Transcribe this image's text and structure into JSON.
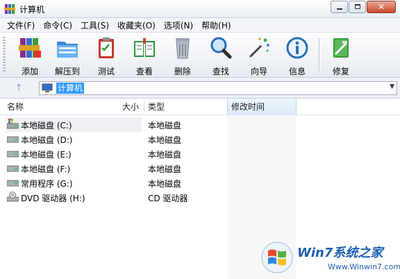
{
  "window": {
    "title": "计算机"
  },
  "menu": [
    "文件(F)",
    "命令(C)",
    "工具(S)",
    "收藏夹(O)",
    "选项(N)",
    "帮助(H)"
  ],
  "toolbar": [
    {
      "label": "添加",
      "icon": "add-archive-icon"
    },
    {
      "label": "解压到",
      "icon": "extract-folder-icon"
    },
    {
      "label": "测试",
      "icon": "test-clipboard-icon"
    },
    {
      "label": "查看",
      "icon": "view-book-icon"
    },
    {
      "label": "删除",
      "icon": "trash-icon"
    },
    {
      "label": "查找",
      "icon": "magnifier-icon"
    },
    {
      "label": "向导",
      "icon": "wizard-wand-icon"
    },
    {
      "label": "信息",
      "icon": "info-icon"
    },
    {
      "label": "修复",
      "icon": "repair-icon"
    }
  ],
  "address": {
    "value": "计算机"
  },
  "columns": {
    "name": "名称",
    "size": "大小",
    "type": "类型",
    "modified": "修改时间"
  },
  "rows": [
    {
      "name": "本地磁盘 (C:)",
      "type": "本地磁盘",
      "icon": "system-drive-icon"
    },
    {
      "name": "本地磁盘 (D:)",
      "type": "本地磁盘",
      "icon": "hard-drive-icon"
    },
    {
      "name": "本地磁盘 (E:)",
      "type": "本地磁盘",
      "icon": "hard-drive-icon"
    },
    {
      "name": "本地磁盘 (F:)",
      "type": "本地磁盘",
      "icon": "hard-drive-icon"
    },
    {
      "name": "常用程序 (G:)",
      "type": "本地磁盘",
      "icon": "hard-drive-icon"
    },
    {
      "name": "DVD 驱动器 (H:)",
      "type": "CD 驱动器",
      "icon": "dvd-drive-icon"
    }
  ],
  "watermark": {
    "brand": "Win7系统之家",
    "url": "Www.Winwin7.com"
  },
  "colors": {
    "selection": "#3399ff",
    "watermark": "#1d5fb0",
    "close": "#c7472d"
  }
}
